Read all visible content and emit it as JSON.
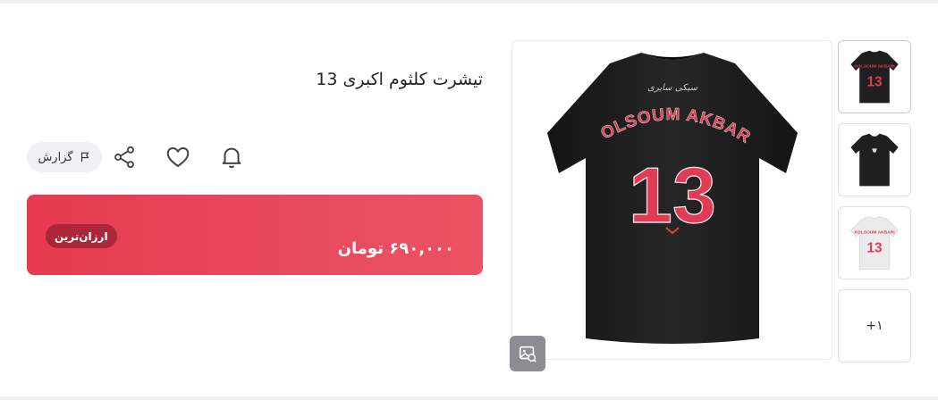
{
  "product": {
    "title": "تیشرت کلثوم اکبری 13",
    "price": "۶۹۰,۰۰۰ تومان",
    "badge": "ارزان‌ترین",
    "jersey_name": "KOLSOUM AKBARI",
    "jersey_number": "13",
    "jersey_signature": "سیکی سایری"
  },
  "actions": {
    "report_label": "گزارش"
  },
  "gallery": {
    "more_count": "+۱"
  },
  "colors": {
    "price_bg": "#e63a50",
    "shirt_black": "#1f1f1f",
    "shirt_white": "#e9e9e9",
    "print_red": "#e23b55"
  }
}
